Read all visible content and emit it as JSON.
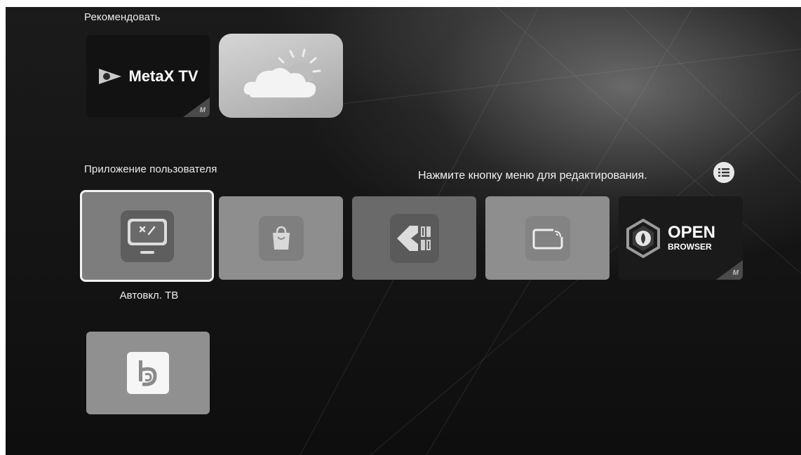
{
  "sections": {
    "recommend_label": "Рекомендовать",
    "user_apps_label": "Приложение пользователя"
  },
  "hint": {
    "text": "Нажмите кнопку меню для редактирования."
  },
  "recommended": [
    {
      "name": "metax-tv",
      "title": "MetaX TV",
      "badge": "M"
    },
    {
      "name": "weather",
      "icon": "cloud-icon"
    }
  ],
  "apps": [
    {
      "name": "autostart-tv",
      "icon": "tv-power-icon",
      "label": "Автовкл. ТВ",
      "focused": true
    },
    {
      "name": "store",
      "icon": "shopping-bag-icon"
    },
    {
      "name": "file-manager",
      "icon": "diamond-file-icon"
    },
    {
      "name": "screen-cast",
      "icon": "cast-icon"
    },
    {
      "name": "open-browser",
      "title_line1": "OPEN",
      "title_line2": "BROWSER",
      "badge": "M"
    },
    {
      "name": "b-app",
      "icon": "b-logo-icon"
    }
  ],
  "colors": {
    "background": "#141414",
    "tile_gray": "#8e8e8e",
    "focus_outline": "#f4f4f4"
  }
}
